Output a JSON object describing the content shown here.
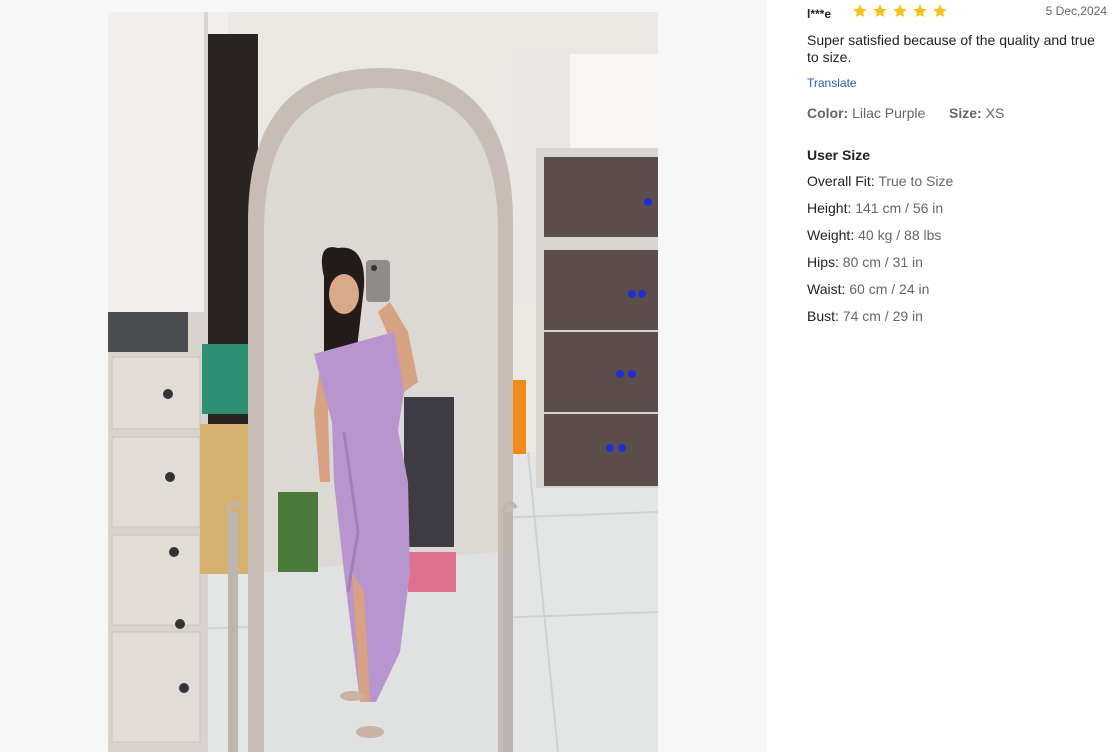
{
  "review": {
    "user": "l***e",
    "rating": 5,
    "date": "5 Dec,2024",
    "text": "Super satisfied because of the quality and true to size.",
    "translate_label": "Translate",
    "color_label": "Color:",
    "color_value": "Lilac Purple",
    "size_label": "Size:",
    "size_value": "XS"
  },
  "user_size": {
    "title": "User Size",
    "items": [
      {
        "label": "Overall Fit:",
        "value": "True to Size"
      },
      {
        "label": "Height:",
        "value": "141 cm / 56 in"
      },
      {
        "label": "Weight:",
        "value": "40 kg / 88 lbs"
      },
      {
        "label": "Hips:",
        "value": "80 cm / 31 in"
      },
      {
        "label": "Waist:",
        "value": "60 cm / 24 in"
      },
      {
        "label": "Bust:",
        "value": "74 cm / 29 in"
      }
    ]
  },
  "icons": {
    "star": "star-icon"
  },
  "colors": {
    "star": "#f8c21b",
    "link": "#2b5ca8",
    "dress": "#b995cf",
    "muted_text": "#666666"
  }
}
